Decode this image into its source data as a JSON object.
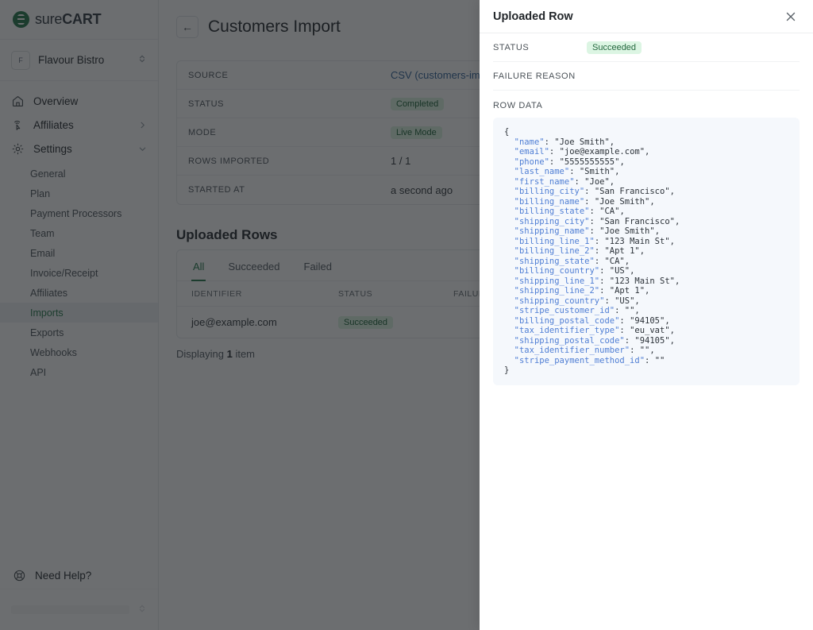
{
  "sidebar": {
    "logo": {
      "part_a": "sure",
      "part_b": "CART"
    },
    "store": {
      "initial": "F",
      "name": "Flavour Bistro"
    },
    "nav": [
      {
        "label": "Overview",
        "icon": "home-icon",
        "chevron": ""
      },
      {
        "label": "Affiliates",
        "icon": "click-icon",
        "chevron": "›"
      },
      {
        "label": "Settings",
        "icon": "gear-icon",
        "chevron": "∨"
      }
    ],
    "subnav": [
      {
        "label": "General",
        "active": false
      },
      {
        "label": "Plan",
        "active": false
      },
      {
        "label": "Payment Processors",
        "active": false
      },
      {
        "label": "Team",
        "active": false
      },
      {
        "label": "Email",
        "active": false
      },
      {
        "label": "Invoice/Receipt",
        "active": false
      },
      {
        "label": "Affiliates",
        "active": false
      },
      {
        "label": "Imports",
        "active": true
      },
      {
        "label": "Exports",
        "active": false
      },
      {
        "label": "Webhooks",
        "active": false
      },
      {
        "label": "API",
        "active": false
      }
    ],
    "help_label": "Need Help?"
  },
  "main": {
    "back_icon": "←",
    "page_title": "Customers Import",
    "details": [
      {
        "key": "SOURCE",
        "value": "CSV (customers-import-",
        "type": "link"
      },
      {
        "key": "STATUS",
        "value": "Completed",
        "type": "badge"
      },
      {
        "key": "MODE",
        "value": "Live Mode",
        "type": "badge"
      },
      {
        "key": "ROWS IMPORTED",
        "value": "1 / 1",
        "type": "text"
      },
      {
        "key": "STARTED AT",
        "value": "a second ago",
        "type": "text"
      }
    ],
    "source_prefix": "CSV (",
    "section_title": "Uploaded Rows",
    "tabs": [
      {
        "label": "All",
        "active": true
      },
      {
        "label": "Succeeded",
        "active": false
      },
      {
        "label": "Failed",
        "active": false
      }
    ],
    "table": {
      "columns": [
        "IDENTIFIER",
        "STATUS",
        "FAILURE R"
      ],
      "rows": [
        {
          "identifier": "joe@example.com",
          "status": "Succeeded",
          "failure_reason": ""
        }
      ]
    },
    "displaying": {
      "prefix": "Displaying ",
      "count": "1",
      "suffix": " item"
    }
  },
  "panel": {
    "title": "Uploaded Row",
    "close_icon": "✕",
    "fields": [
      {
        "key": "STATUS",
        "value": "Succeeded",
        "type": "badge"
      },
      {
        "key": "FAILURE REASON",
        "value": "",
        "type": "text"
      }
    ],
    "row_data_label": "ROW DATA",
    "row_data": {
      "name": "Joe Smith",
      "email": "joe@example.com",
      "phone": "5555555555",
      "last_name": "Smith",
      "first_name": "Joe",
      "billing_city": "San Francisco",
      "billing_name": "Joe Smith",
      "billing_state": "CA",
      "shipping_city": "San Francisco",
      "shipping_name": "Joe Smith",
      "billing_line_1": "123 Main St",
      "billing_line_2": "Apt 1",
      "shipping_state": "CA",
      "billing_country": "US",
      "shipping_line_1": "123 Main St",
      "shipping_line_2": "Apt 1",
      "shipping_country": "US",
      "stripe_customer_id": "",
      "billing_postal_code": "94105",
      "tax_identifier_type": "eu_vat",
      "shipping_postal_code": "94105",
      "tax_identifier_number": "",
      "stripe_payment_method_id": ""
    }
  },
  "colors": {
    "brand_green": "#2e7d52",
    "badge_bg": "#dcf5e3",
    "badge_text": "#25683f",
    "json_bg": "#f5f8fc",
    "json_key": "#4f7ed4",
    "overlay": "rgba(18,21,24,0.62)"
  }
}
